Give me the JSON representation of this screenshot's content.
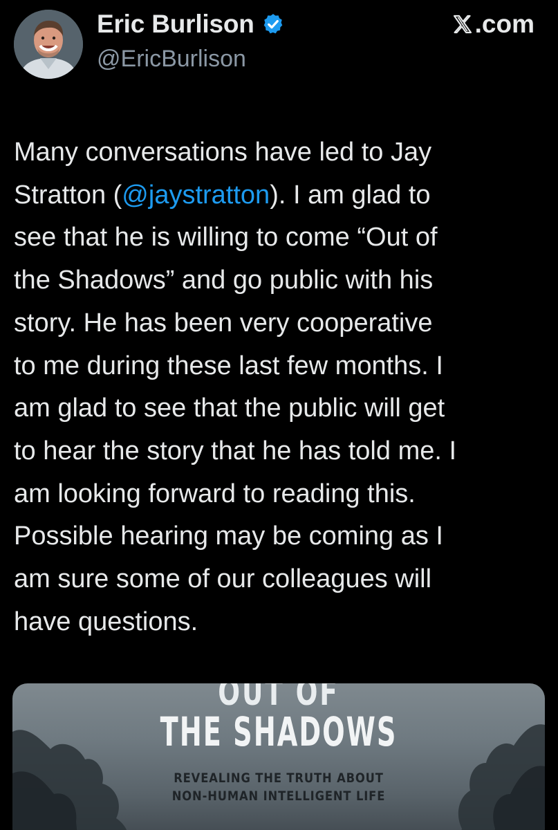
{
  "header": {
    "display_name": "Eric Burlison",
    "handle": "@EricBurlison",
    "site": ".com",
    "site_logo_icon": "x-logo-icon",
    "verified_icon": "verified-badge-icon",
    "verified_color": "#1d9bf0"
  },
  "tweet": {
    "lines": [
      {
        "before": "Many conversations have led to Jay"
      },
      {
        "before": "Stratton (",
        "mention": "@jaystratton",
        "after": "). I am glad to"
      },
      {
        "before": "see that he is willing to come “Out of"
      },
      {
        "before": "the Shadows” and go public with his"
      },
      {
        "before": "story. He has been very cooperative"
      },
      {
        "before": "to me during these last few months. I"
      },
      {
        "before": "am glad to see that the public will get"
      },
      {
        "before": "to hear the story that he has told me. I"
      },
      {
        "before": "am looking forward to reading this."
      },
      {
        "before": "Possible hearing may be coming as I"
      },
      {
        "before": "am sure some of our colleagues will"
      },
      {
        "before": "have questions."
      }
    ],
    "mention_color": "#1d9bf0"
  },
  "media": {
    "cover_top": "OUT OF",
    "cover_title": "THE SHADOWS",
    "cover_subtitle_1": "REVEALING THE TRUTH ABOUT",
    "cover_subtitle_2": "NON-HUMAN INTELLIGENT LIFE"
  }
}
